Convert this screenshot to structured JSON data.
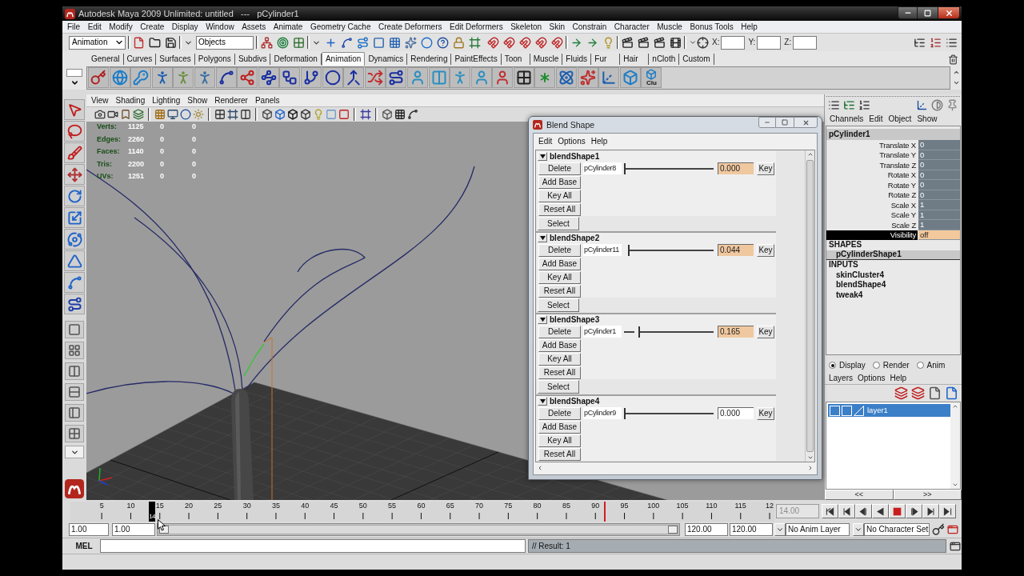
{
  "window": {
    "title": "Autodesk Maya 2009 Unlimited: untitled   ---   pCylinder1"
  },
  "menu_bar": [
    "File",
    "Edit",
    "Modify",
    "Create",
    "Display",
    "Window",
    "Assets",
    "Animate",
    "Geometry Cache",
    "Create Deformers",
    "Edit Deformers",
    "Skeleton",
    "Skin",
    "Constrain",
    "Character",
    "Muscle",
    "Bonus Tools",
    "Help"
  ],
  "status_line": {
    "menu_set": "Animation",
    "selection_mode": "Objects",
    "coordinates": [
      "X:",
      "Y:",
      "Z:"
    ]
  },
  "shelf": {
    "tabs": [
      {
        "label": "General",
        "selected": false
      },
      {
        "label": "Curves",
        "selected": false
      },
      {
        "label": "Surfaces",
        "selected": false
      },
      {
        "label": "Polygons",
        "selected": false
      },
      {
        "label": "Subdivs",
        "selected": false
      },
      {
        "label": "Deformation",
        "selected": false
      },
      {
        "label": "Animation",
        "selected": true
      },
      {
        "label": "Dynamics",
        "selected": false
      },
      {
        "label": "Rendering",
        "selected": false
      },
      {
        "label": "PaintEffects",
        "selected": false
      },
      {
        "label": "Toon",
        "selected": false
      },
      {
        "label": "Muscle",
        "selected": false
      },
      {
        "label": "Fluids",
        "selected": false
      },
      {
        "label": "Fur",
        "selected": false
      },
      {
        "label": "Hair",
        "selected": false
      },
      {
        "label": "nCloth",
        "selected": false
      },
      {
        "label": "Custom",
        "selected": false
      }
    ],
    "tool_caption": "Clu"
  },
  "viewport": {
    "menu": [
      "View",
      "Shading",
      "Lighting",
      "Show",
      "Renderer",
      "Panels"
    ],
    "hud": [
      {
        "label": "Verts:",
        "values": [
          "1125",
          "0",
          "0"
        ]
      },
      {
        "label": "Edges:",
        "values": [
          "2260",
          "0",
          "0"
        ]
      },
      {
        "label": "Faces:",
        "values": [
          "1140",
          "0",
          "0"
        ]
      },
      {
        "label": "Tris:",
        "values": [
          "2200",
          "0",
          "0"
        ]
      },
      {
        "label": "UVs:",
        "values": [
          "1251",
          "0",
          "0"
        ]
      }
    ]
  },
  "blend_shape": {
    "title": "Blend Shape",
    "menu": [
      "Edit",
      "Options",
      "Help"
    ],
    "shapes": [
      {
        "name": "blendShape1",
        "expanded": true,
        "delete": "Delete",
        "target": "pCylinder8",
        "level": 0,
        "value": "0.000",
        "keyed": true,
        "key": "Key",
        "buttons": [
          "Add Base",
          "Key All",
          "Reset All"
        ],
        "select": "Select"
      },
      {
        "name": "blendShape2",
        "expanded": true,
        "delete": "Delete",
        "target": "pCylinder11",
        "level": 0.044,
        "value": "0.044",
        "keyed": true,
        "key": "Key",
        "buttons": [
          "Add Base",
          "Key All",
          "Reset All"
        ],
        "select": "Select"
      },
      {
        "name": "blendShape3",
        "expanded": true,
        "delete": "Delete",
        "target": "pCylinder1",
        "level": 0.165,
        "value": "0.165",
        "keyed": true,
        "key": "Key",
        "buttons": [
          "Add Base",
          "Key All",
          "Reset All"
        ],
        "select": "Select"
      },
      {
        "name": "blendShape4",
        "expanded": true,
        "delete": "Delete",
        "target": "pCylinder9",
        "level": 0,
        "value": "0.000",
        "keyed": false,
        "key": "Key",
        "buttons": [
          "Add Base",
          "Key All",
          "Reset All"
        ]
      }
    ]
  },
  "channel_box": {
    "menu": [
      "Channels",
      "Edit",
      "Object",
      "Show"
    ],
    "object": "pCylinder1",
    "attributes": [
      {
        "name": "Translate X",
        "value": "0",
        "selected": false,
        "keyed": false
      },
      {
        "name": "Translate Y",
        "value": "0",
        "selected": false,
        "keyed": false
      },
      {
        "name": "Translate Z",
        "value": "0",
        "selected": false,
        "keyed": false
      },
      {
        "name": "Rotate X",
        "value": "0",
        "selected": false,
        "keyed": false
      },
      {
        "name": "Rotate Y",
        "value": "0",
        "selected": false,
        "keyed": false
      },
      {
        "name": "Rotate Z",
        "value": "0",
        "selected": false,
        "keyed": false
      },
      {
        "name": "Scale X",
        "value": "1",
        "selected": false,
        "keyed": false
      },
      {
        "name": "Scale Y",
        "value": "1",
        "selected": false,
        "keyed": false
      },
      {
        "name": "Scale Z",
        "value": "1",
        "selected": false,
        "keyed": false
      },
      {
        "name": "Visibility",
        "value": "off",
        "selected": true,
        "keyed": true
      }
    ],
    "shapes_header": "SHAPES",
    "shapes": [
      {
        "name": "pCylinderShape1",
        "selected": true
      }
    ],
    "inputs_header": "INPUTS",
    "inputs": [
      "skinCluster4",
      "blendShape4",
      "tweak4"
    ]
  },
  "layer_editor": {
    "modes": [
      {
        "label": "Display",
        "selected": true
      },
      {
        "label": "Render",
        "selected": false
      },
      {
        "label": "Anim",
        "selected": false
      }
    ],
    "menu": [
      "Layers",
      "Options",
      "Help"
    ],
    "layers": [
      {
        "name": "layer1",
        "selected": true,
        "visible": false,
        "template": false
      }
    ],
    "pager": [
      "<<",
      ">>"
    ]
  },
  "time_slider": {
    "labels": [
      "5",
      "10",
      "15",
      "20",
      "25",
      "30",
      "35",
      "40",
      "45",
      "50",
      "55",
      "60",
      "65",
      "70",
      "75",
      "80",
      "85",
      "90",
      "95",
      "100",
      "105",
      "110",
      "115",
      "12"
    ],
    "playhead": {
      "label": "14",
      "level": 0.116
    },
    "key_marks": [
      {
        "level": 0.758
      }
    ],
    "current_time": "14.00"
  },
  "range_slider": {
    "start": "1.00",
    "playback_start": "1.00",
    "level": 1,
    "playback_end": "120.00",
    "end": "120.00",
    "anim_layer": "No Anim Layer",
    "character_set": "No Character Set"
  },
  "command_line": {
    "language": "MEL",
    "result": "// Result: 1"
  }
}
